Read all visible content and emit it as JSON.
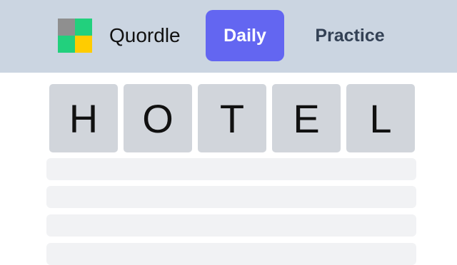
{
  "header": {
    "app_title": "Quordle",
    "tabs": [
      {
        "label": "Daily",
        "active": true
      },
      {
        "label": "Practice",
        "active": false
      }
    ]
  },
  "colors": {
    "header_bg": "#cbd5e1",
    "active_tab": "#6366f1",
    "tile_bg": "#d1d5db",
    "empty_row": "#f1f2f4"
  },
  "board": {
    "current_guess": [
      "H",
      "O",
      "T",
      "E",
      "L"
    ],
    "empty_rows_visible": 4
  }
}
